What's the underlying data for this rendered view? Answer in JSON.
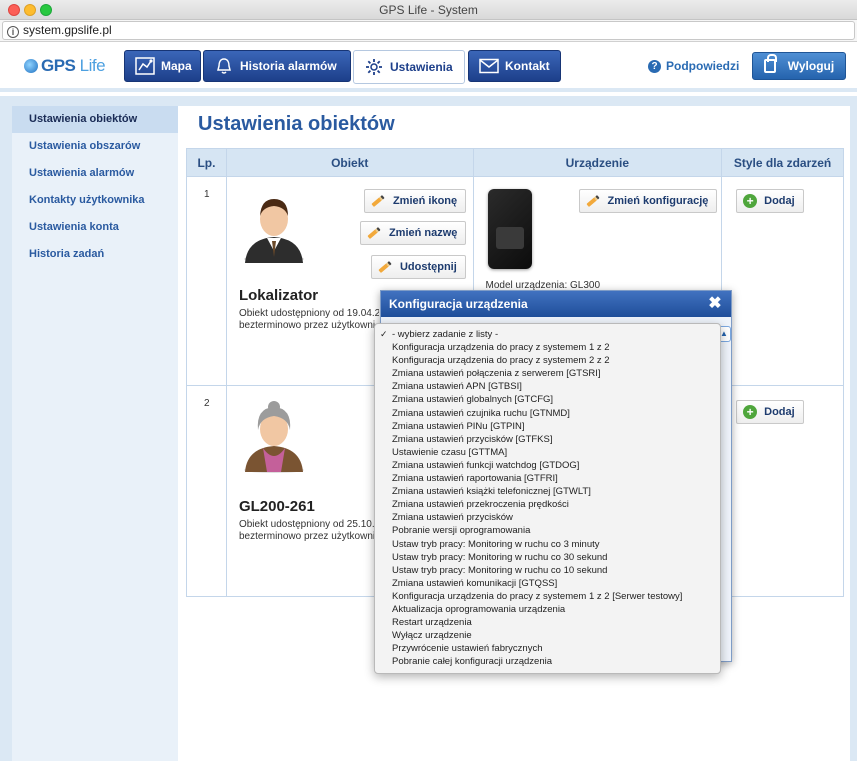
{
  "window": {
    "title": "GPS Life - System",
    "url": "system.gpslife.pl"
  },
  "header": {
    "logo_gps": "GPS",
    "logo_life": "Life",
    "nav": [
      {
        "label": "Mapa",
        "icon": "map-icon"
      },
      {
        "label": "Historia alarmów",
        "icon": "bell-icon"
      },
      {
        "label": "Ustawienia",
        "icon": "gear-icon",
        "active": true
      },
      {
        "label": "Kontakt",
        "icon": "envelope-icon"
      }
    ],
    "help_label": "Podpowiedzi",
    "logout_label": "Wyloguj"
  },
  "sidebar": {
    "items": [
      {
        "label": "Ustawienia obiektów",
        "active": true
      },
      {
        "label": "Ustawienia obszarów"
      },
      {
        "label": "Ustawienia alarmów"
      },
      {
        "label": "Kontakty użytkownika"
      },
      {
        "label": "Ustawienia konta"
      },
      {
        "label": "Historia zadań"
      }
    ]
  },
  "main": {
    "title": "Ustawienia obiektów",
    "columns": [
      "Lp.",
      "Obiekt",
      "Urządzenie",
      "Style dla zdarzeń"
    ],
    "rows": [
      {
        "lp": "1",
        "name": "Lokalizator",
        "note_line1": "Obiekt udostępniony od 19.04.2",
        "note_line2": "bezterminowo przez użytkowni",
        "btn_icon": "Zmień ikonę",
        "btn_name": "Zmień nazwę",
        "btn_share": "Udostępnij",
        "btn_config": "Zmień konfigurację",
        "model_line": "Model urządzenia:   GL300",
        "btn_add": "Dodaj"
      },
      {
        "lp": "2",
        "name": "GL200-261",
        "note_line1": "Obiekt udostępniony od 25.10.",
        "note_line2": "bezterminowo przez użytkowni",
        "btn_add": "Dodaj"
      }
    ]
  },
  "modal": {
    "title": "Konfiguracja urządzenia",
    "close": "✖",
    "options": [
      "- wybierz zadanie z listy -",
      "Konfiguracja urządzenia do pracy z systemem 1 z 2",
      "Konfiguracja urządzenia do pracy z systemem 2 z 2",
      "Zmiana ustawień połączenia z serwerem [GTSRI]",
      "Zmiana ustawień APN [GTBSI]",
      "Zmiana ustawień globalnych [GTCFG]",
      "Zmiana ustawień czujnika ruchu [GTNMD]",
      "Zmiana ustawień PINu [GTPIN]",
      "Zmiana ustawień przycisków [GTFKS]",
      "Ustawienie czasu [GTTMA]",
      "Zmiana ustawień funkcji watchdog [GTDOG]",
      "Zmiana ustawień raportowania [GTFRI]",
      "Zmiana ustawień książki telefonicznej [GTWLT]",
      "Zmiana ustawień przekroczenia prędkości",
      "Zmiana ustawień przycisków",
      "Pobranie wersji oprogramowania",
      "Ustaw tryb pracy: Monitoring w ruchu co 3 minuty",
      "Ustaw tryb pracy: Monitoring w ruchu co 30 sekund",
      "Ustaw tryb pracy: Monitoring w ruchu co 10 sekund",
      "Zmiana ustawień komunikacji [GTQSS]",
      "Konfiguracja urządzenia do pracy z systemem 1 z 2 [Serwer testowy]",
      "Aktualizacja oprogramowania urządzenia",
      "Restart urządzenia",
      "Wyłącz urządzenie",
      "Przywrócenie ustawień fabrycznych",
      "Pobranie całej konfiguracji urządzenia"
    ]
  },
  "colors": {
    "nav_blue": "#1d3f8a",
    "accent": "#2a5aa0",
    "page_bg": "#dbe8f4",
    "add_green": "#4fa63c"
  }
}
